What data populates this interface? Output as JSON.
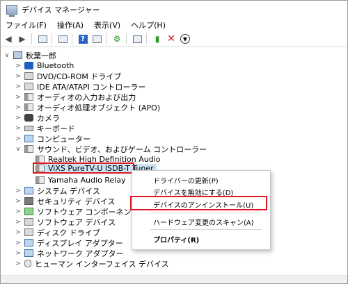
{
  "window": {
    "title": "デバイス マネージャー"
  },
  "menu": [
    "ファイル(F)",
    "操作(A)",
    "表示(V)",
    "ヘルプ(H)"
  ],
  "tree": {
    "root": "秋葉一郎",
    "categories": [
      "Bluetooth",
      "DVD/CD-ROM ドライブ",
      "IDE ATA/ATAPI コントローラー",
      "オーディオの入力および出力",
      "オーディオ処理オブジェクト (APO)",
      "カメラ",
      "キーボード",
      "コンピューター",
      "サウンド、ビデオ、およびゲーム コントローラー",
      "システム デバイス",
      "セキュリティ デバイス",
      "ソフトウェア コンポーネント",
      "ソフトウェア デバイス",
      "ディスク ドライブ",
      "ディスプレイ アダプター",
      "ネットワーク アダプター",
      "ヒューマン インターフェイス デバイス"
    ],
    "sound_children": [
      "Realtek High Definition Audio",
      "ViXS PureTV-U ISDB-T Tuner",
      "Yamaha Audio Relay"
    ]
  },
  "context_menu": {
    "items": [
      "ドライバーの更新(P)",
      "デバイスを無効にする(D)",
      "デバイスのアンインストール(U)",
      "ハードウェア変更のスキャン(A)",
      "プロパティ(R)"
    ]
  }
}
